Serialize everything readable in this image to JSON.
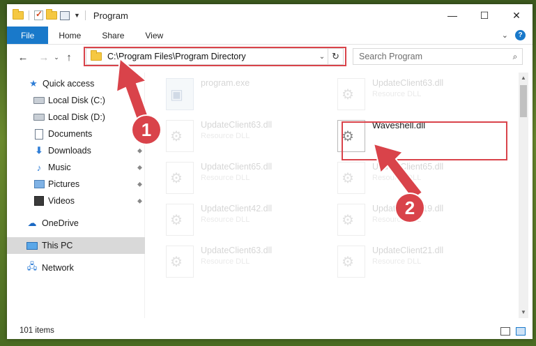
{
  "window": {
    "title": "Program",
    "controls": {
      "minimize": "—",
      "maximize": "☐",
      "close": "✕"
    }
  },
  "ribbon": {
    "tabs": [
      "File",
      "Home",
      "Share",
      "View"
    ],
    "expand": "⌄",
    "help": "?"
  },
  "navbar": {
    "back": "←",
    "forward": "→",
    "recent": "⌄",
    "up": "↑",
    "address": "C:\\Program Files\\Program Directory",
    "address_dropdown": "⌄",
    "refresh": "↻",
    "search_placeholder": "Search Program",
    "search_icon": "⌕"
  },
  "sidebar": {
    "items": [
      {
        "label": "Quick access",
        "icon": "star-icon",
        "pinned": false
      },
      {
        "label": "Local Disk (C:)",
        "icon": "drive-icon",
        "pinned": true
      },
      {
        "label": "Local Disk (D:)",
        "icon": "drive-icon",
        "pinned": false
      },
      {
        "label": "Documents",
        "icon": "documents-icon",
        "pinned": true
      },
      {
        "label": "Downloads",
        "icon": "download-icon",
        "pinned": true
      },
      {
        "label": "Music",
        "icon": "music-icon",
        "pinned": true
      },
      {
        "label": "Pictures",
        "icon": "pictures-icon",
        "pinned": true
      },
      {
        "label": "Videos",
        "icon": "videos-icon",
        "pinned": true
      },
      {
        "label": "OneDrive",
        "icon": "cloud-icon",
        "pinned": false
      },
      {
        "label": "This PC",
        "icon": "pc-icon",
        "pinned": false,
        "selected": true
      },
      {
        "label": "Network",
        "icon": "network-icon",
        "pinned": false
      }
    ],
    "pin_glyph": "📌"
  },
  "files": [
    {
      "name": "program.exe",
      "type": "",
      "faded": true,
      "kind": "exe"
    },
    {
      "name": "UpdateClient63.dll",
      "type": "Resource DLL",
      "faded": true,
      "kind": "dll"
    },
    {
      "name": "UpdateClient63.dll",
      "type": "Resource DLL",
      "faded": true,
      "kind": "dll"
    },
    {
      "name": "Waveshell.dll",
      "type": "",
      "faded": false,
      "kind": "dll"
    },
    {
      "name": "UpdateClient65.dll",
      "type": "Resource DLL",
      "faded": true,
      "kind": "dll"
    },
    {
      "name": "UpdateClient65.dll",
      "type": "Resource DLL",
      "faded": true,
      "kind": "dll"
    },
    {
      "name": "UpdateClient42.dll",
      "type": "Resource DLL",
      "faded": true,
      "kind": "dll"
    },
    {
      "name": "UpdateClient19.dll",
      "type": "Resource DLL",
      "faded": true,
      "kind": "dll"
    },
    {
      "name": "UpdateClient63.dll",
      "type": "Resource DLL",
      "faded": true,
      "kind": "dll"
    },
    {
      "name": "UpdateClient21.dll",
      "type": "Resource DLL",
      "faded": true,
      "kind": "dll"
    }
  ],
  "status": {
    "item_count": "101 items"
  },
  "callouts": {
    "step1": "1",
    "step2": "2",
    "color": "#d9434a"
  }
}
